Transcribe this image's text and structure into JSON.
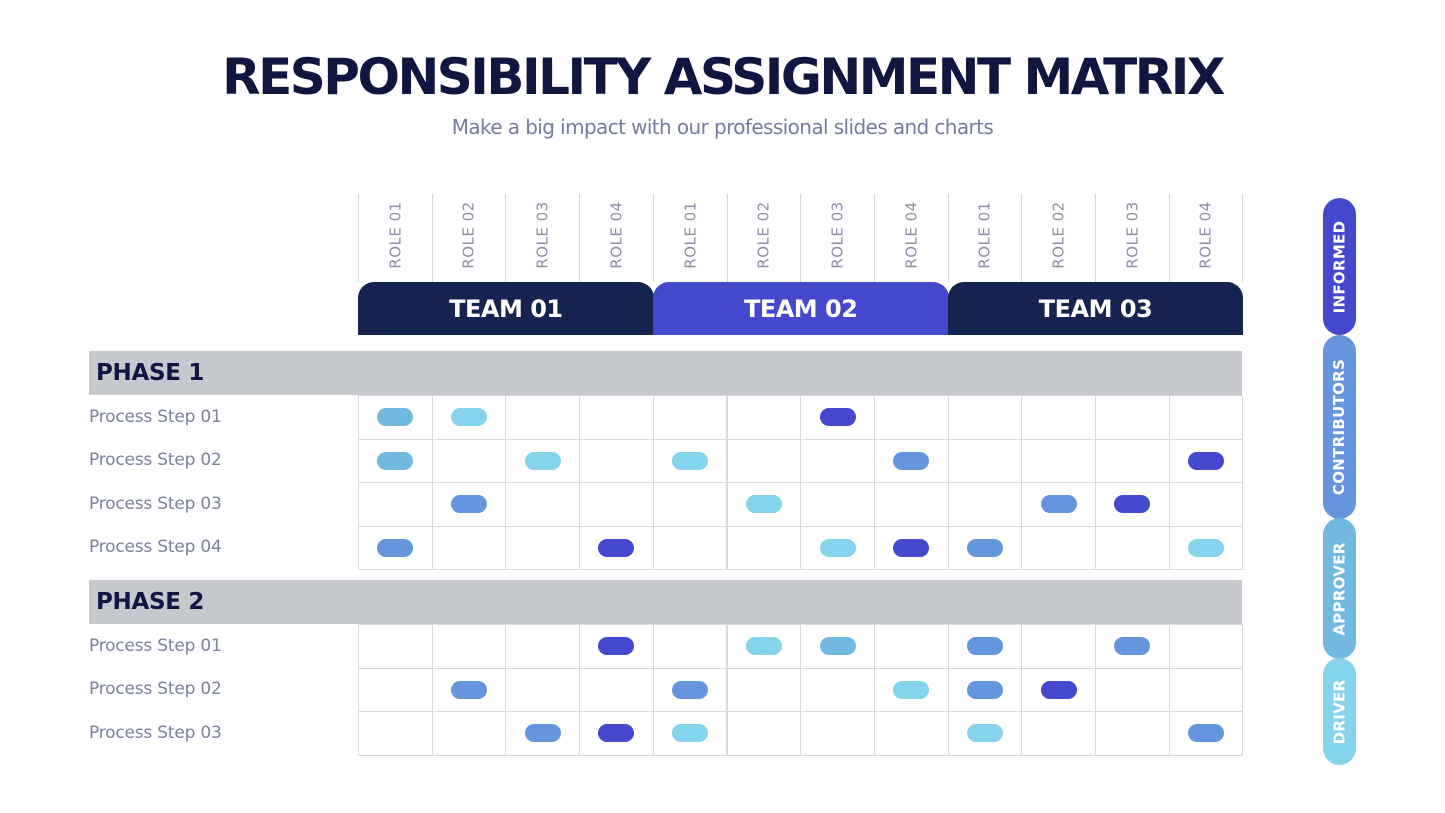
{
  "title": "RESPONSIBILITY ASSIGNMENT MATRIX",
  "subtitle": "Make a big impact with our professional slides and charts",
  "chart_data": {
    "type": "table",
    "title": "RESPONSIBILITY ASSIGNMENT MATRIX",
    "teams": [
      {
        "label": "TEAM 01",
        "color": "#15244f",
        "roles": [
          "ROLE 01",
          "ROLE 02",
          "ROLE 03",
          "ROLE 04"
        ]
      },
      {
        "label": "TEAM 02",
        "color": "#4348cc",
        "roles": [
          "ROLE 01",
          "ROLE 02",
          "ROLE 03",
          "ROLE 04"
        ]
      },
      {
        "label": "TEAM 03",
        "color": "#15244f",
        "roles": [
          "ROLE 01",
          "ROLE 02",
          "ROLE 03",
          "ROLE 04"
        ]
      }
    ],
    "legend": [
      {
        "key": "informed",
        "label": "INFORMED",
        "color": "#4348cc"
      },
      {
        "key": "contributor",
        "label": "CONTRIBUTORS",
        "color": "#6595dd"
      },
      {
        "key": "approver",
        "label": "APPROVER",
        "color": "#72b9e0"
      },
      {
        "key": "driver",
        "label": "DRIVER",
        "color": "#86d4ec"
      }
    ],
    "phases": [
      {
        "label": "PHASE 1",
        "steps": [
          {
            "label": "Process Step 01",
            "cells": [
              "approver",
              "driver",
              "",
              "",
              "",
              "",
              "informed",
              "",
              "",
              "",
              "",
              ""
            ]
          },
          {
            "label": "Process Step 02",
            "cells": [
              "approver",
              "",
              "driver",
              "",
              "driver",
              "",
              "",
              "contributor",
              "",
              "",
              "",
              "informed"
            ]
          },
          {
            "label": "Process Step 03",
            "cells": [
              "",
              "contributor",
              "",
              "",
              "",
              "driver",
              "",
              "",
              "",
              "contributor",
              "informed",
              ""
            ]
          },
          {
            "label": "Process Step 04",
            "cells": [
              "contributor",
              "",
              "",
              "informed",
              "",
              "",
              "driver",
              "informed",
              "contributor",
              "",
              "",
              "driver"
            ]
          }
        ]
      },
      {
        "label": "PHASE 2",
        "steps": [
          {
            "label": "Process Step 01",
            "cells": [
              "",
              "",
              "",
              "informed",
              "",
              "driver",
              "approver",
              "",
              "contributor",
              "",
              "contributor",
              ""
            ]
          },
          {
            "label": "Process Step 02",
            "cells": [
              "",
              "contributor",
              "",
              "",
              "contributor",
              "",
              "",
              "driver",
              "contributor",
              "informed",
              "",
              ""
            ]
          },
          {
            "label": "Process Step 03",
            "cells": [
              "",
              "",
              "contributor",
              "informed",
              "driver",
              "",
              "",
              "",
              "driver",
              "",
              "",
              "contributor"
            ]
          }
        ]
      }
    ]
  }
}
